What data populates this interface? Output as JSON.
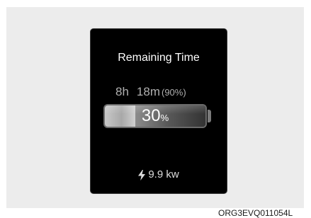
{
  "display": {
    "title": "Remaining Time",
    "time_hours": "8h",
    "time_minutes": "18m",
    "time_target": "(90%)",
    "charge_value": "30",
    "charge_unit": "%",
    "charge_level_percent": 30,
    "power": "9.9 kw",
    "power_icon": "lightning-bolt-icon"
  },
  "image_code": "ORG3EVQ011054L",
  "colors": {
    "screen_bg": "#000000",
    "text_primary": "#ffffff",
    "text_secondary": "#b0b0b0"
  }
}
